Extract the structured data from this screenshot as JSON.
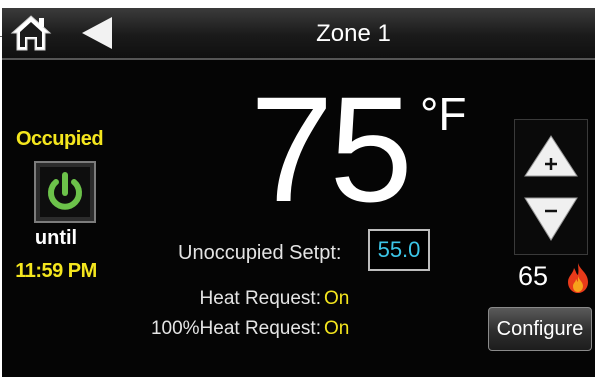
{
  "header": {
    "title": "Zone 1",
    "home_icon": "home-icon",
    "back_icon": "back-arrow-icon"
  },
  "occupancy": {
    "status": "Occupied",
    "power_icon": "power-icon",
    "until_label": "until",
    "until_time": "11:59 PM"
  },
  "temperature": {
    "value": "75",
    "unit": "°F"
  },
  "setpoint": {
    "label": "Unoccupied Setpt:",
    "value": "55.0"
  },
  "heat_request": {
    "label": "Heat Request:",
    "value": "On"
  },
  "heat_request_100": {
    "label": "100%Heat Request:",
    "value": "On"
  },
  "controls": {
    "up_icon": "up-arrow-plus-icon",
    "down_icon": "down-arrow-minus-icon",
    "current_value": "65",
    "flame_icon": "flame-icon",
    "configure_label": "Configure"
  },
  "colors": {
    "background": "#050505",
    "accent_yellow": "#f4e61e",
    "setpoint_cyan": "#3cc6e8",
    "power_green": "#6cc24a",
    "flame_red": "#e83a1a"
  }
}
